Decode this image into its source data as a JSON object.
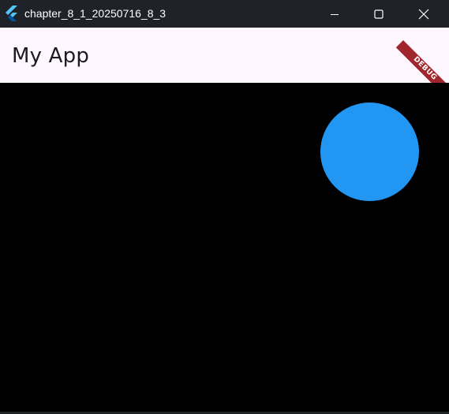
{
  "window": {
    "title": "chapter_8_1_20250716_8_3",
    "app_icon": "flutter-logo-icon",
    "controls": {
      "minimize_icon": "minimize-icon",
      "maximize_icon": "maximize-icon",
      "close_icon": "close-icon"
    }
  },
  "appbar": {
    "title": "My App",
    "background": "#fef7ff"
  },
  "debug_banner": {
    "label": "DEBUG",
    "color": "#a0262d"
  },
  "canvas": {
    "background": "#000000",
    "shape": "circle",
    "shape_color": "#2196f3"
  }
}
